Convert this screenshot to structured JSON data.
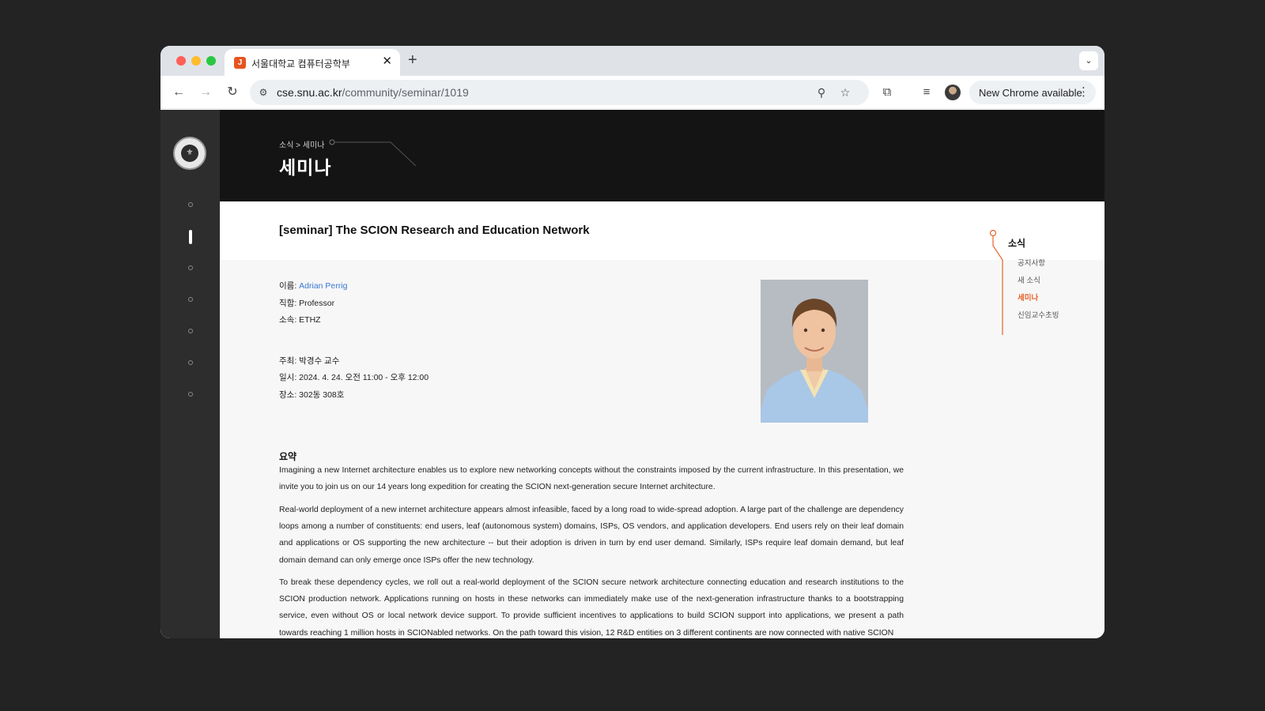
{
  "browser": {
    "tab_title": "서울대학교 컴퓨터공학부",
    "tab_favicon_glyph": "J",
    "url_host": "cse.snu.ac.kr",
    "url_path": "/community/seminar/1019",
    "new_chrome_label": "New Chrome available",
    "icons": {
      "back": "back-arrow-icon",
      "forward": "forward-arrow-icon",
      "reload": "reload-icon",
      "zoom": "zoom-icon",
      "bookmark": "star-icon",
      "extensions": "puzzle-icon",
      "media": "media-control-icon",
      "profile": "avatar",
      "menu": "kebab-menu-icon"
    }
  },
  "site": {
    "breadcrumb": "소식 > 세미나",
    "page_title": "세미나",
    "side_nav": {
      "heading": "소식",
      "items": [
        {
          "label": "공지사항",
          "active": false
        },
        {
          "label": "새 소식",
          "active": false
        },
        {
          "label": "세미나",
          "active": true
        },
        {
          "label": "신임교수초빙",
          "active": false
        }
      ]
    },
    "accent_color": "#e8632b"
  },
  "seminar": {
    "title": "[seminar] The SCION Research and Education Network",
    "name_label": "이름: ",
    "name": "Adrian Perrig",
    "position": "직함: Professor",
    "affiliation": "소속: ETHZ",
    "host": "주최: 박경수 교수",
    "datetime": "일시: 2024. 4. 24. 오전 11:00 - 오후 12:00",
    "place": "장소: 302동 308호",
    "summary_heading": "요약",
    "paragraphs": [
      "Imagining a new Internet architecture enables us to explore new networking concepts without the constraints imposed by the current infrastructure. In this presentation, we invite you to join us on our 14 years long expedition for creating the SCION next-generation secure Internet architecture.",
      "Real-world deployment of a new internet architecture appears almost infeasible, faced by a long road to wide-spread adoption. A large part of the challenge are dependency loops among a number of constituents: end users, leaf (autonomous system) domains, ISPs, OS vendors, and application developers. End users rely on their leaf domain and applications or OS supporting the new architecture -- but their adoption is driven in turn by end user demand. Similarly, ISPs require leaf domain demand, but leaf domain demand can only emerge once ISPs offer the new technology.",
      "To break these dependency cycles, we roll out a real-world deployment of the SCION secure network architecture connecting education and research institutions to the SCION production network. Applications running on hosts in these networks can immediately make use of the next-generation infrastructure thanks to a bootstrapping service, even without OS or local network device support. To provide sufficient incentives to applications to build SCION support into applications, we present a path towards reaching 1 million hosts in SCIONabled networks. On the path toward this vision, 12 R&D entities on 3 different continents are now connected with native SCION"
    ]
  }
}
